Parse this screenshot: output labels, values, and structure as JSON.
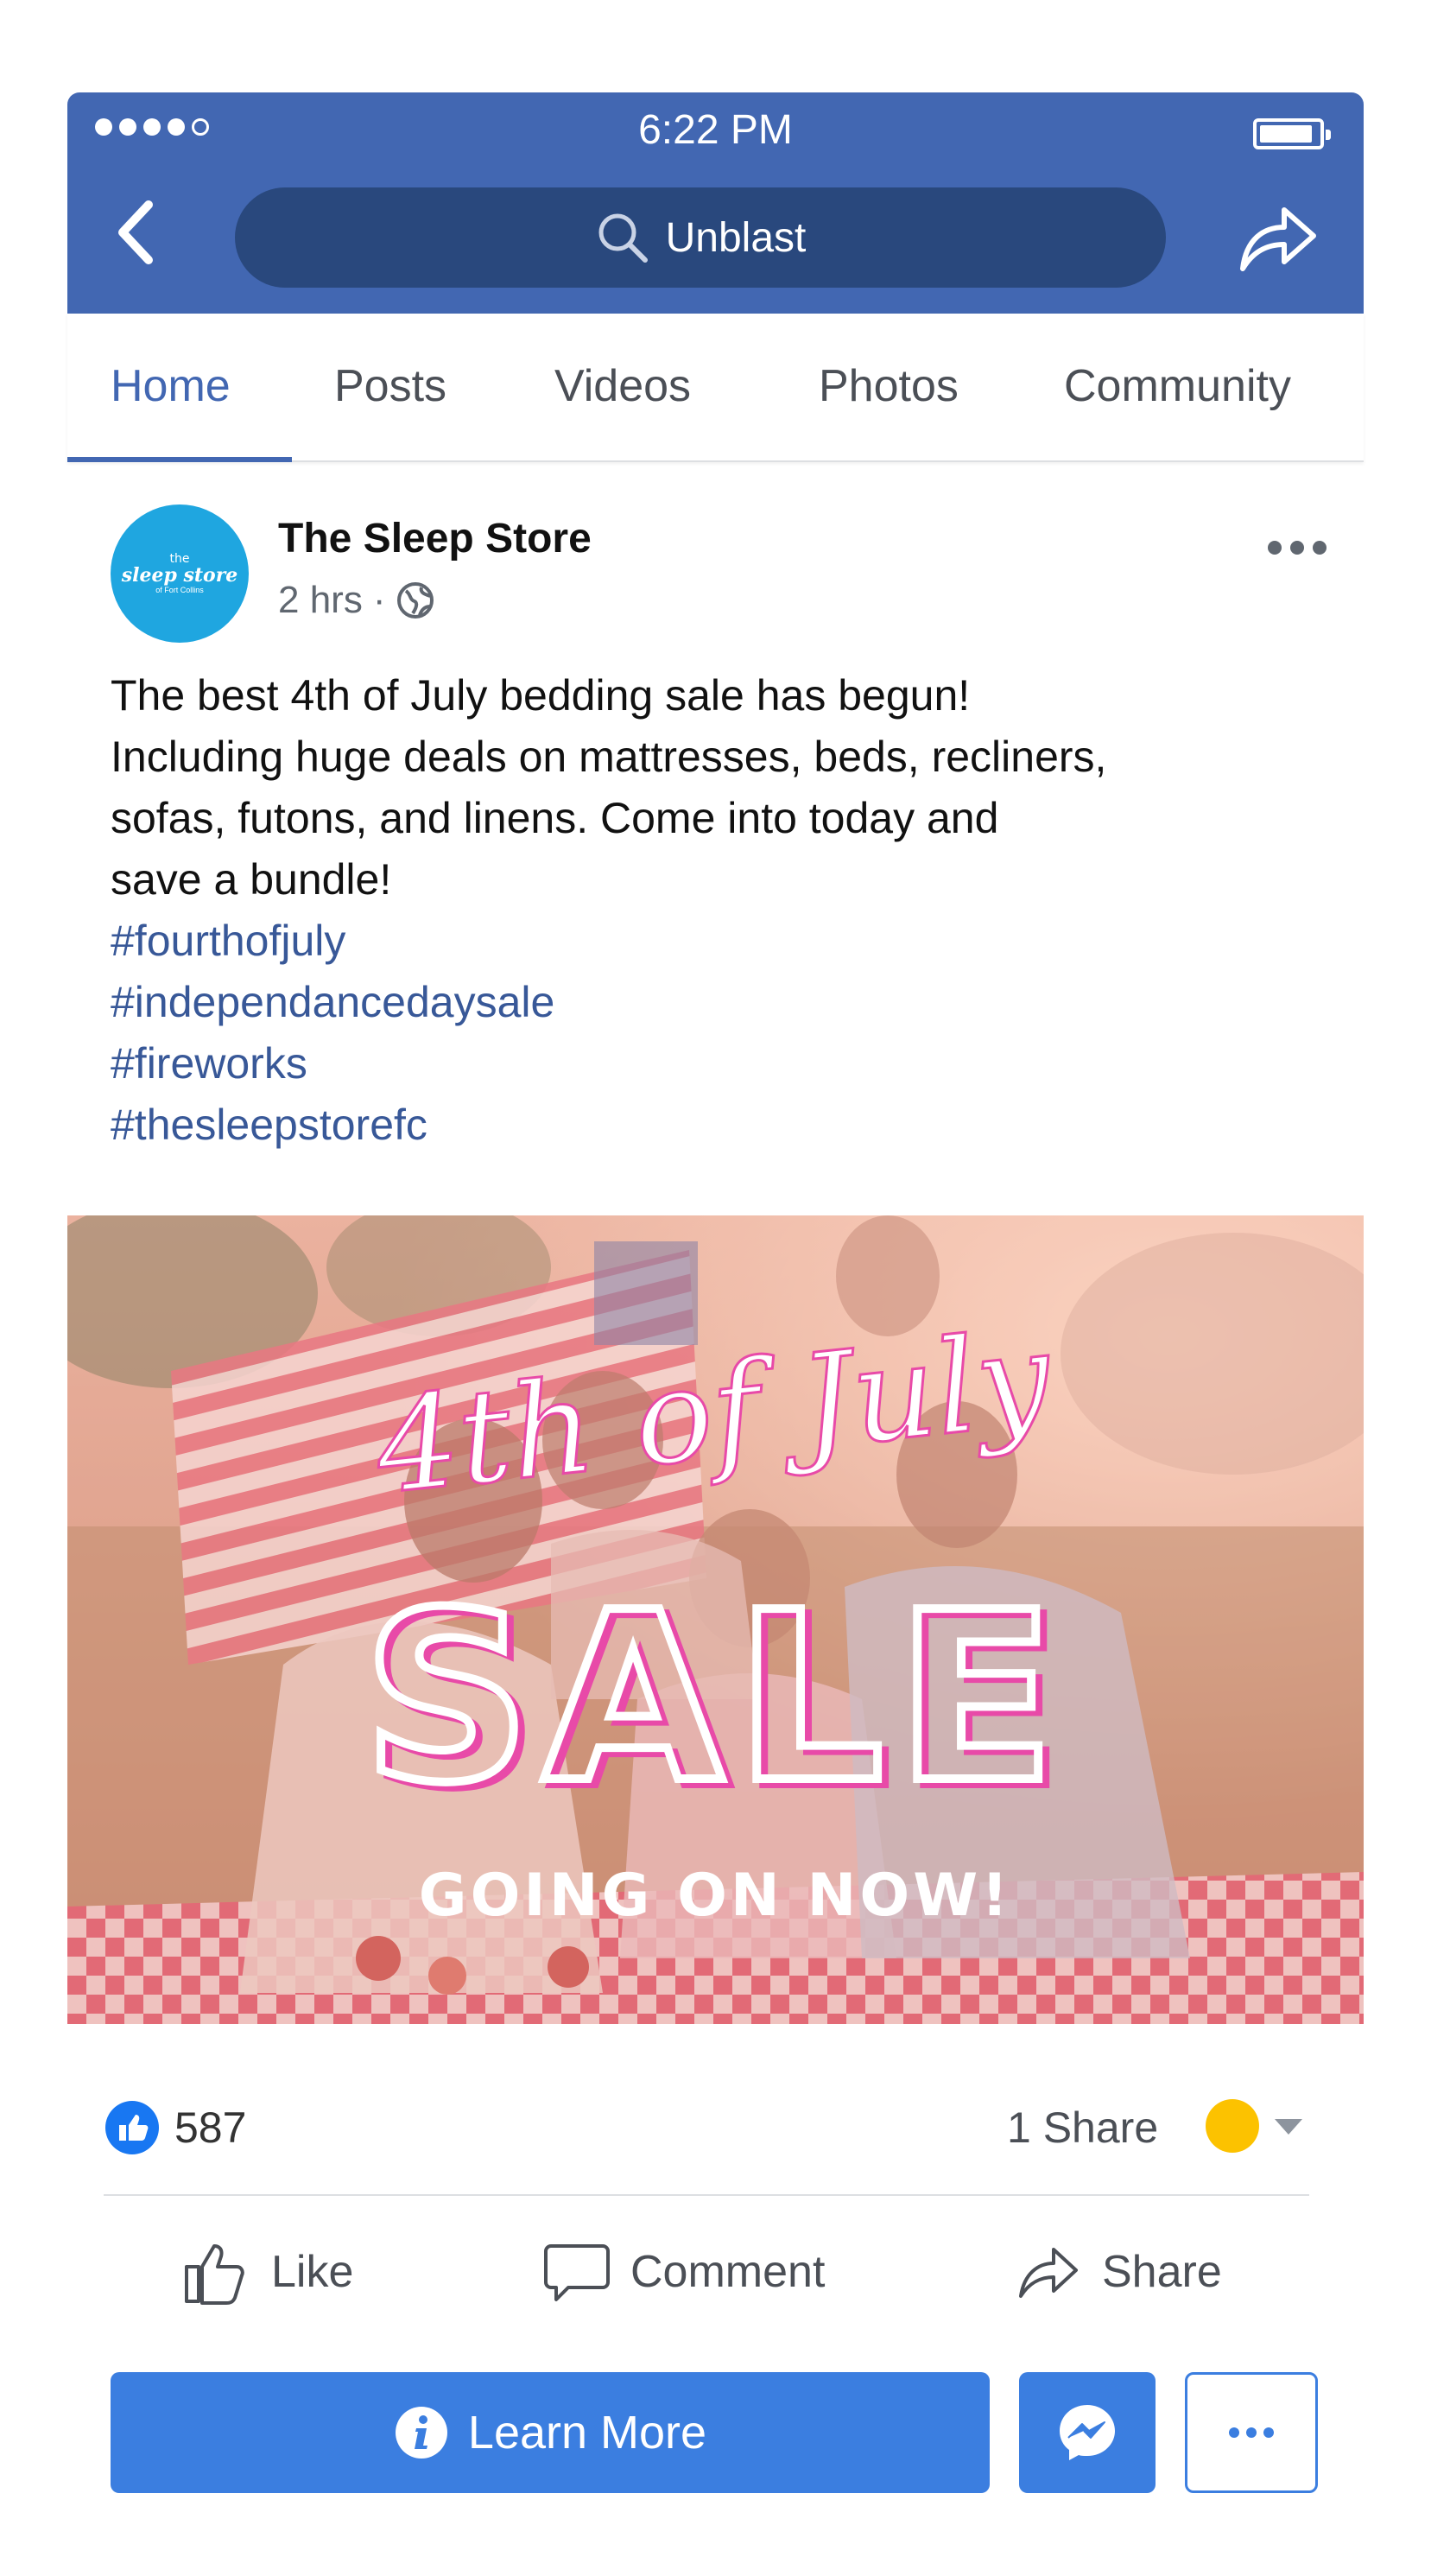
{
  "status_bar": {
    "time": "6:22 PM"
  },
  "search": {
    "query": "Unblast"
  },
  "tabs": [
    {
      "label": "Home"
    },
    {
      "label": "Posts"
    },
    {
      "label": "Videos"
    },
    {
      "label": "Photos"
    },
    {
      "label": "Community"
    }
  ],
  "post": {
    "page_name": "The Sleep Store",
    "avatar_text": {
      "line1": "the",
      "line2": "sleep store",
      "line3": "of Fort Collins"
    },
    "time": "2 hrs",
    "separator": "·",
    "body": "The best 4th of July bedding sale has begun!\nIncluding huge deals on mattresses, beds, recliners,\nsofas, futons, and linens. Come into today and\nsave a bundle!",
    "hashtags": [
      "#fourthofjuly",
      "#independancedaysale",
      "#fireworks",
      "#thesleepstorefc"
    ],
    "image": {
      "headline": "4th of July",
      "big_text": "SALE",
      "subtext": "GOING ON NOW!"
    },
    "like_count": "587",
    "share_count": "1 Share"
  },
  "actions": {
    "like": "Like",
    "comment": "Comment",
    "share": "Share"
  },
  "buttons": {
    "learn_more": "Learn More"
  },
  "colors": {
    "facebook_blue": "#4267b2",
    "search_bg": "#29487d",
    "link_blue": "#385898",
    "cta_blue": "#3b7ee0",
    "avatar_cyan": "#1fa6e0",
    "reaction_yellow": "#fcc200"
  }
}
